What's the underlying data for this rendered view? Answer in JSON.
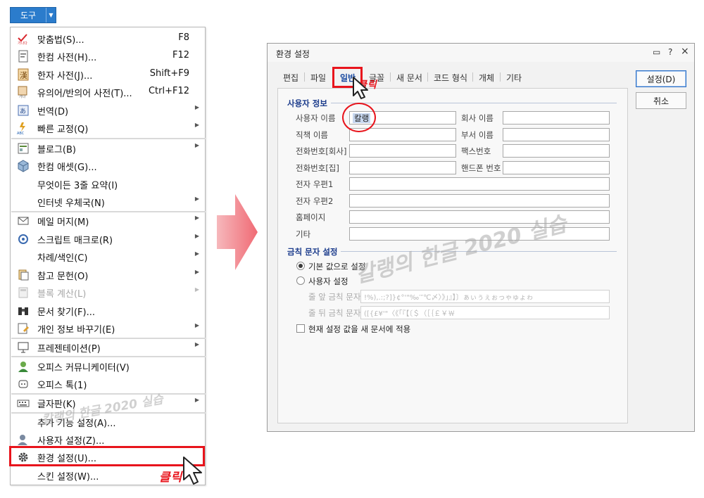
{
  "toolbar": {
    "button_label": "도구"
  },
  "menu": {
    "items": [
      {
        "label": "맞춤법(S)...",
        "shortcut": "F8"
      },
      {
        "label": "한컴 사전(H)...",
        "shortcut": "F12"
      },
      {
        "label": "한자 사전(J)...",
        "shortcut": "Shift+F9"
      },
      {
        "label": "유의어/반의어 사전(T)...",
        "shortcut": "Ctrl+F12"
      },
      {
        "label": "번역(D)"
      },
      {
        "label": "빠른 교정(Q)"
      },
      {
        "label": "블로그(B)"
      },
      {
        "label": "한컴 애셋(G)..."
      },
      {
        "label": "무엇이든 3줄 요약(I)"
      },
      {
        "label": "인터넷 우체국(N)"
      },
      {
        "label": "메일 머지(M)"
      },
      {
        "label": "스크립트 매크로(R)"
      },
      {
        "label": "차례/색인(C)"
      },
      {
        "label": "참고 문헌(O)"
      },
      {
        "label": "블록 계산(L)"
      },
      {
        "label": "문서 찾기(F)..."
      },
      {
        "label": "개인 정보 바꾸기(E)"
      },
      {
        "label": "프레젠테이션(P)"
      },
      {
        "label": "오피스 커뮤니케이터(V)"
      },
      {
        "label": "오피스 톡(1)"
      },
      {
        "label": "글자판(K)"
      },
      {
        "label": "추가 기능 설정(A)..."
      },
      {
        "label": "사용자 설정(Z)..."
      },
      {
        "label": "환경 설정(U)..."
      },
      {
        "label": "스킨 설정(W)..."
      }
    ]
  },
  "annotations": {
    "click_label": "클릭",
    "watermark": "칼랭의 한글 2020 실습"
  },
  "dialog": {
    "title": "환경 설정",
    "controls": {
      "help": "?",
      "close": "×"
    },
    "tabs": [
      "편집",
      "파일",
      "일반",
      "글꼴",
      "새 문서",
      "코드 형식",
      "개체",
      "기타"
    ],
    "buttons": {
      "ok": "설정(D)",
      "cancel": "취소"
    },
    "user_info": {
      "section": "사용자 정보",
      "fields": {
        "username": {
          "label": "사용자 이름",
          "value": "칼랭"
        },
        "company": {
          "label": "회사 이름",
          "value": ""
        },
        "title": {
          "label": "직책 이름",
          "value": ""
        },
        "department": {
          "label": "부서 이름",
          "value": ""
        },
        "phone_office": {
          "label": "전화번호[회사]",
          "value": ""
        },
        "fax": {
          "label": "팩스번호",
          "value": ""
        },
        "phone_home": {
          "label": "전화번호[집]",
          "value": ""
        },
        "mobile": {
          "label": "핸드폰 번호",
          "value": ""
        },
        "email1": {
          "label": "전자 우편1",
          "value": ""
        },
        "email2": {
          "label": "전자 우편2",
          "value": ""
        },
        "homepage": {
          "label": "홈페이지",
          "value": ""
        },
        "etc": {
          "label": "기타",
          "value": ""
        }
      }
    },
    "forbidden": {
      "section": "금칙 문자 설정",
      "default_label": "기본 값으로 설정",
      "custom_label": "사용자 설정",
      "front_label": "줄 앞 금칙 문자",
      "front_value": "!%),.:;?]}¢°'\"‰′″℃〆〉》」』】〕ぁぃぅぇぉっゃゅょゎ",
      "back_label": "줄 뒤 금칙 문자",
      "back_value": "([{£¥'\"〈《「『【〔＄（［｛￡￥￦",
      "apply_label": "현재 설정 값을 새 문서에 적용"
    }
  }
}
